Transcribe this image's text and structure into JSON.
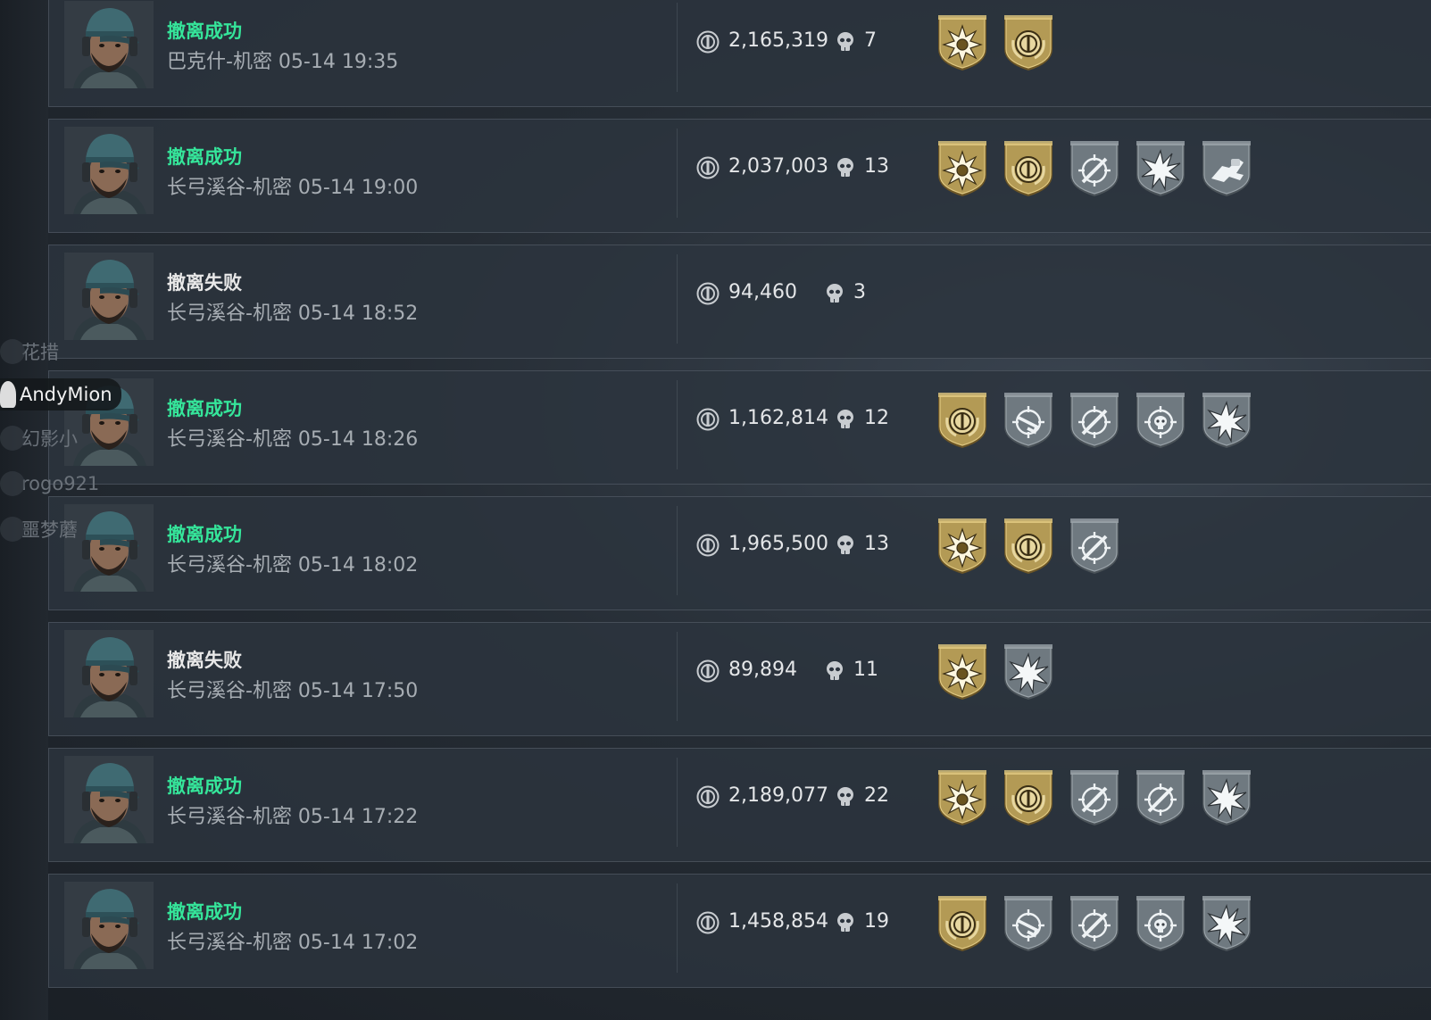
{
  "friends": [
    {
      "name": "花措",
      "active": false
    },
    {
      "name": "AndyMion",
      "active": true
    },
    {
      "name": "幻影小",
      "active": false
    },
    {
      "name": "rogo921",
      "active": false
    },
    {
      "name": "噩梦蘑",
      "active": false
    }
  ],
  "colors": {
    "success": "#35e59a",
    "fail": "#e8e8e8",
    "badge_gold": "#b8a060",
    "badge_silver": "#7e878e"
  },
  "matches": [
    {
      "status": "撤离成功",
      "result": "success",
      "info": "巴克什-机密 05-14 19:35",
      "value": "2,165,319",
      "kills": "7",
      "badges": [
        {
          "type": "gold",
          "icon": "burst-icon"
        },
        {
          "type": "gold",
          "icon": "coin-wreath-icon"
        }
      ]
    },
    {
      "status": "撤离成功",
      "result": "success",
      "info": "长弓溪谷-机密 05-14 19:00",
      "value": "2,037,003",
      "kills": "13",
      "badges": [
        {
          "type": "gold",
          "icon": "burst-icon"
        },
        {
          "type": "gold",
          "icon": "coin-wreath-icon"
        },
        {
          "type": "silver",
          "icon": "crosshair-rifle-icon"
        },
        {
          "type": "silver",
          "icon": "explosion-icon"
        },
        {
          "type": "silver",
          "icon": "carry-icon"
        }
      ]
    },
    {
      "status": "撤离失败",
      "result": "fail",
      "info": "长弓溪谷-机密 05-14 18:52",
      "value": "94,460",
      "kills": "3",
      "badges": []
    },
    {
      "status": "撤离成功",
      "result": "success",
      "info": "长弓溪谷-机密 05-14 18:26",
      "value": "1,162,814",
      "kills": "12",
      "badges": [
        {
          "type": "gold",
          "icon": "coin-wreath-icon"
        },
        {
          "type": "silver",
          "icon": "crosshair-gun-icon"
        },
        {
          "type": "silver",
          "icon": "crosshair-rifle-icon"
        },
        {
          "type": "silver",
          "icon": "crosshair-skull-icon"
        },
        {
          "type": "silver",
          "icon": "explosion-icon"
        }
      ]
    },
    {
      "status": "撤离成功",
      "result": "success",
      "info": "长弓溪谷-机密 05-14 18:02",
      "value": "1,965,500",
      "kills": "13",
      "badges": [
        {
          "type": "gold",
          "icon": "burst-icon"
        },
        {
          "type": "gold",
          "icon": "coin-wreath-icon"
        },
        {
          "type": "silver",
          "icon": "crosshair-rifle-icon"
        }
      ]
    },
    {
      "status": "撤离失败",
      "result": "fail",
      "info": "长弓溪谷-机密 05-14 17:50",
      "value": "89,894",
      "kills": "11",
      "badges": [
        {
          "type": "gold",
          "icon": "burst-icon"
        },
        {
          "type": "silver",
          "icon": "explosion-icon"
        }
      ]
    },
    {
      "status": "撤离成功",
      "result": "success",
      "info": "长弓溪谷-机密 05-14 17:22",
      "value": "2,189,077",
      "kills": "22",
      "badges": [
        {
          "type": "gold",
          "icon": "burst-icon"
        },
        {
          "type": "gold",
          "icon": "coin-wreath-icon"
        },
        {
          "type": "silver",
          "icon": "crosshair-rifle-icon"
        },
        {
          "type": "silver",
          "icon": "crosshair-rifle-icon"
        },
        {
          "type": "silver",
          "icon": "explosion-icon"
        }
      ]
    },
    {
      "status": "撤离成功",
      "result": "success",
      "info": "长弓溪谷-机密 05-14 17:02",
      "value": "1,458,854",
      "kills": "19",
      "badges": [
        {
          "type": "gold",
          "icon": "coin-wreath-icon"
        },
        {
          "type": "silver",
          "icon": "crosshair-gun-icon"
        },
        {
          "type": "silver",
          "icon": "crosshair-rifle-icon"
        },
        {
          "type": "silver",
          "icon": "crosshair-skull-icon"
        },
        {
          "type": "silver",
          "icon": "explosion-icon"
        }
      ]
    }
  ]
}
